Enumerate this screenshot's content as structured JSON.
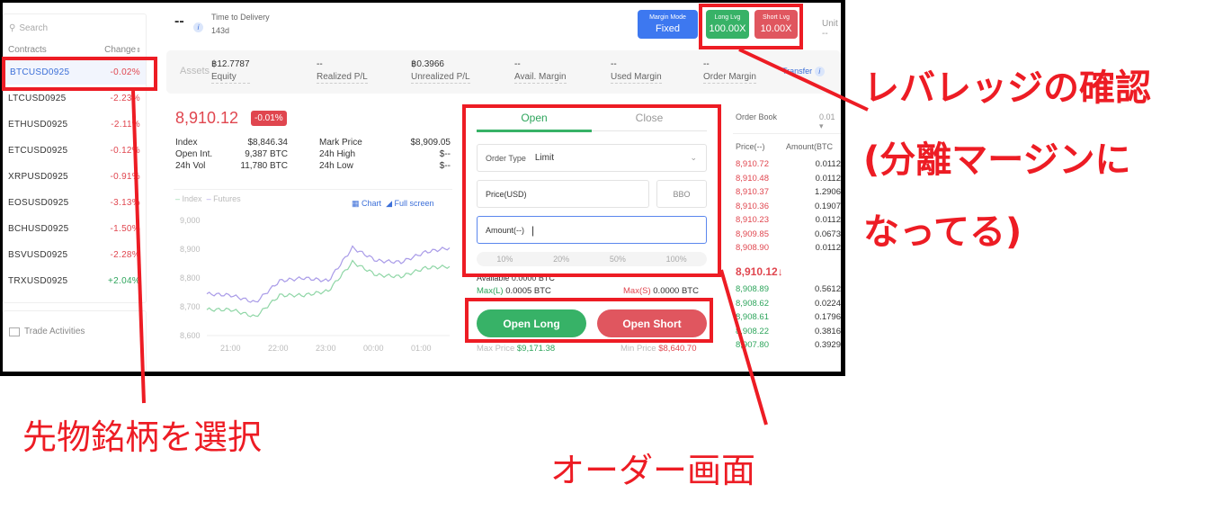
{
  "sidebar": {
    "search_placeholder": "Search",
    "col_contracts": "Contracts",
    "col_change": "Change",
    "contracts": [
      {
        "name": "BTCUSD0925",
        "change": "-0.02%",
        "dir": "neg",
        "active": true
      },
      {
        "name": "LTCUSD0925",
        "change": "-2.23%",
        "dir": "neg"
      },
      {
        "name": "ETHUSD0925",
        "change": "-2.11%",
        "dir": "neg"
      },
      {
        "name": "ETCUSD0925",
        "change": "-0.12%",
        "dir": "neg"
      },
      {
        "name": "XRPUSD0925",
        "change": "-0.91%",
        "dir": "neg"
      },
      {
        "name": "EOSUSD0925",
        "change": "-3.13%",
        "dir": "neg"
      },
      {
        "name": "BCHUSD0925",
        "change": "-1.50%",
        "dir": "neg"
      },
      {
        "name": "BSVUSD0925",
        "change": "-2.28%",
        "dir": "neg"
      },
      {
        "name": "TRXUSD0925",
        "change": "+2.04%",
        "dir": "pos"
      }
    ],
    "trade_activities": "Trade Activities"
  },
  "header": {
    "symbol_placeholder": "--",
    "delivery_label": "Time to Delivery",
    "delivery_value": "143d",
    "margin_mode_label": "Margin Mode",
    "margin_mode_value": "Fixed",
    "long_lev_label": "Long Lvg",
    "long_lev_value": "100.00X",
    "short_lev_label": "Short Lvg",
    "short_lev_value": "10.00X",
    "unit_label": "Unit"
  },
  "assets": {
    "title": "Assets",
    "items": [
      {
        "value": "฿12.7787",
        "label": "Equity"
      },
      {
        "value": "--",
        "label": "Realized P/L"
      },
      {
        "value": "฿0.3966",
        "label": "Unrealized P/L"
      },
      {
        "value": "--",
        "label": "Avail. Margin"
      },
      {
        "value": "--",
        "label": "Used Margin"
      },
      {
        "value": "--",
        "label": "Order Margin"
      }
    ],
    "transfer": "Transfer"
  },
  "market": {
    "last_price": "8,910.12",
    "change_badge": "-0.01%",
    "stats": [
      {
        "label": "Index",
        "value": "$8,846.34"
      },
      {
        "label": "Open Int.",
        "value": "9,387 BTC"
      },
      {
        "label": "24h Vol",
        "value": "11,780 BTC"
      },
      {
        "label": "Mark Price",
        "value": "$8,909.05"
      },
      {
        "label": "24h High",
        "value": "$--"
      },
      {
        "label": "24h Low",
        "value": "$--"
      }
    ],
    "legend_index": "Index",
    "legend_futures": "Futures",
    "chart_link": "Chart",
    "fullscreen_link": "Full screen",
    "colors": {
      "index": "#8fd6a6",
      "futures": "#a99be8"
    }
  },
  "chart_data": {
    "type": "line",
    "title": "",
    "xlabel": "",
    "ylabel": "",
    "x_ticks": [
      "21:00",
      "22:00",
      "23:00",
      "00:00",
      "01:00"
    ],
    "y_ticks": [
      "8,600",
      "8,700",
      "8,800",
      "8,900",
      "9,000"
    ],
    "ylim": [
      8600,
      9000
    ],
    "x": [
      "20:30",
      "21:00",
      "21:30",
      "22:00",
      "22:30",
      "23:00",
      "23:30",
      "00:00",
      "00:30",
      "01:00",
      "01:30"
    ],
    "series": [
      {
        "name": "Futures",
        "values": [
          8745,
          8740,
          8715,
          8790,
          8800,
          8790,
          8905,
          8860,
          8855,
          8890,
          8905
        ]
      },
      {
        "name": "Index",
        "values": [
          8690,
          8690,
          8665,
          8740,
          8740,
          8755,
          8855,
          8810,
          8805,
          8835,
          8840
        ]
      }
    ]
  },
  "order": {
    "tab_open": "Open",
    "tab_close": "Close",
    "order_type_label": "Order Type",
    "order_type_value": "Limit",
    "price_placeholder": "Price(USD)",
    "bbo": "BBO",
    "amount_placeholder": "Amount(--)",
    "percents": [
      "10%",
      "20%",
      "50%",
      "100%"
    ],
    "available": "Available 0.0000 BTC",
    "max_long_label": "Max(L)",
    "max_long_value": "0.0005 BTC",
    "max_short_label": "Max(S)",
    "max_short_value": "0.0000 BTC",
    "open_long": "Open Long",
    "open_short": "Open Short",
    "max_price_label": "Max Price",
    "max_price_value": "$9,171.38",
    "min_price_label": "Min Price",
    "min_price_value": "$8,640.70"
  },
  "orderbook": {
    "title": "Order Book",
    "precision": "0.01",
    "col_price": "Price(--)",
    "col_amount": "Amount(BTC",
    "asks": [
      {
        "price": "8,910.72",
        "amount": "0.0112"
      },
      {
        "price": "8,910.48",
        "amount": "0.0112"
      },
      {
        "price": "8,910.37",
        "amount": "1.2906"
      },
      {
        "price": "8,910.36",
        "amount": "0.1907"
      },
      {
        "price": "8,910.23",
        "amount": "0.0112"
      },
      {
        "price": "8,909.85",
        "amount": "0.0673"
      },
      {
        "price": "8,908.90",
        "amount": "0.0112"
      }
    ],
    "last": "8,910.12↓",
    "bids": [
      {
        "price": "8,908.89",
        "amount": "0.5612"
      },
      {
        "price": "8,908.62",
        "amount": "0.0224"
      },
      {
        "price": "8,908.61",
        "amount": "0.1796"
      },
      {
        "price": "8,908.22",
        "amount": "0.3816"
      },
      {
        "price": "8,907.80",
        "amount": "0.3929"
      }
    ]
  },
  "annotations": {
    "leverage_line1": "レバレッジの確認",
    "leverage_line2": "(分離マージンに",
    "leverage_line3": "なってる)",
    "select_contract": "先物銘柄を選択",
    "order_screen": "オーダー画面",
    "color": "#ed1c24"
  }
}
